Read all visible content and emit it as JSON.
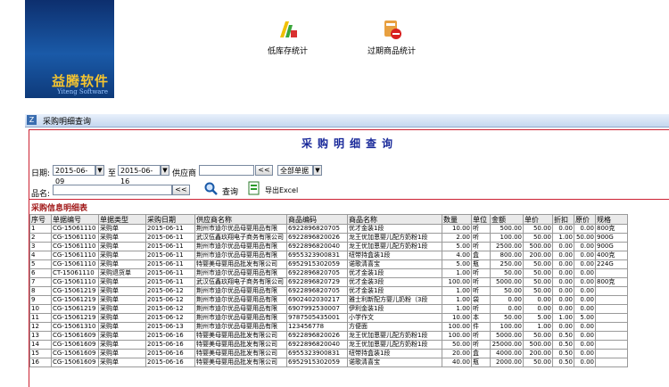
{
  "brand": {
    "logo": "益腾软件",
    "sub": "Yiteng Software"
  },
  "shortcuts": [
    {
      "label": "低库存统计",
      "icon": "low-stock-icon"
    },
    {
      "label": "过期商品统计",
      "icon": "expired-goods-icon"
    }
  ],
  "window": {
    "title": "采购明细查询",
    "heading": "采购明细查询"
  },
  "filters": {
    "date_label": "日期:",
    "date_from": "2015-06-09",
    "to_label": "至",
    "date_to": "2015-06-16",
    "supplier_label": "供应商",
    "supplier_value": "",
    "supplier_btn": "<<",
    "type_select": "全部单据",
    "product_label": "品名:",
    "product_value": "",
    "product_btn": "<<",
    "query_label": "查询",
    "export_label": "导出Excel"
  },
  "section_title": "采购信息明细表",
  "table": {
    "columns": [
      "序号",
      "单据编号",
      "单据类型",
      "采购日期",
      "供应商名称",
      "商品编码",
      "商品名称",
      "数量",
      "单位",
      "金额",
      "单价",
      "折扣",
      "原价",
      "规格"
    ],
    "rows": [
      [
        "1",
        "CG-15061110",
        "采购单",
        "2015-06-11",
        "荆州市迪尔优品母婴用品有限",
        "6922896820705",
        "优才金装1段",
        "10.00",
        "听",
        "500.00",
        "50.00",
        "0.00",
        "0.00",
        "800克"
      ],
      [
        "2",
        "CG-15061110",
        "采购单",
        "2015-06-11",
        "武汉伍鑫玖翔电子商务有限公司",
        "6922896820026",
        "龙王优加恩婴儿配方奶粉1段",
        "2.00",
        "听",
        "100.00",
        "50.00",
        "1.00",
        "50.00",
        "900G"
      ],
      [
        "3",
        "CG-15061110",
        "采购单",
        "2015-06-11",
        "荆州市迪尔优品母婴用品有限",
        "6922896820040",
        "龙王优加恩婴儿配方奶粉1段",
        "5.00",
        "听",
        "2500.00",
        "500.00",
        "0.00",
        "0.00",
        "900G"
      ],
      [
        "4",
        "CG-15061110",
        "采购单",
        "2015-06-11",
        "荆州市迪尔优品母婴用品有限",
        "6955323900831",
        "纽带持盒装1段",
        "4.00",
        "盒",
        "800.00",
        "200.00",
        "0.00",
        "0.00",
        "400克"
      ],
      [
        "5",
        "CG-15061110",
        "采购单",
        "2015-06-11",
        "特婴美母婴用品批发有限公司",
        "6952915302059",
        "诺歌清喜宝",
        "5.00",
        "瓶",
        "250.00",
        "50.00",
        "0.00",
        "0.00",
        "224G"
      ],
      [
        "6",
        "CT-15061110",
        "采购退货单",
        "2015-06-11",
        "荆州市迪尔优品母婴用品有限",
        "6922896820705",
        "优才金装1段",
        "1.00",
        "听",
        "50.00",
        "50.00",
        "0.00",
        "0.00",
        ""
      ],
      [
        "7",
        "CG-15061110",
        "采购单",
        "2015-06-11",
        "武汉伍鑫玖翔电子商务有限公司",
        "6922896820729",
        "优才金装3段",
        "100.00",
        "听",
        "5000.00",
        "50.00",
        "0.00",
        "0.00",
        "800克"
      ],
      [
        "8",
        "CG-15061219",
        "采购单",
        "2015-06-12",
        "荆州市迪尔优品母婴用品有限",
        "6922896820705",
        "优才金装1段",
        "1.00",
        "听",
        "50.00",
        "50.00",
        "0.00",
        "0.00",
        ""
      ],
      [
        "9",
        "CG-15061219",
        "采购单",
        "2015-06-12",
        "荆州市迪尔优品母婴用品有限",
        "6902402030217",
        "雅士利新配方婴儿奶粉（3段",
        "1.00",
        "袋",
        "0.00",
        "0.00",
        "0.00",
        "0.00",
        ""
      ],
      [
        "10",
        "CG-15061219",
        "采购单",
        "2015-06-12",
        "荆州市迪尔优品母婴用品有限",
        "6907992530007",
        "伊利金装1段",
        "1.00",
        "听",
        "0.00",
        "0.00",
        "0.00",
        "0.00",
        ""
      ],
      [
        "11",
        "CG-15061219",
        "采购单",
        "2015-06-12",
        "荆州市迪尔优品母婴用品有限",
        "9787505435001",
        "小学作文",
        "10.00",
        "本",
        "50.00",
        "5.00",
        "1.00",
        "5.00",
        ""
      ],
      [
        "12",
        "CG-15061310",
        "采购单",
        "2015-06-13",
        "荆州市迪尔优品母婴用品有限",
        "123456778",
        "方便面",
        "100.00",
        "件",
        "100.00",
        "1.00",
        "0.00",
        "0.00",
        ""
      ],
      [
        "13",
        "CG-15061609",
        "采购单",
        "2015-06-16",
        "特婴美母婴用品批发有限公司",
        "6922896820026",
        "龙王优加恩婴儿配方奶粉1段",
        "100.00",
        "听",
        "5000.00",
        "50.00",
        "0.50",
        "0.00",
        ""
      ],
      [
        "14",
        "CG-15061609",
        "采购单",
        "2015-06-16",
        "特婴美母婴用品批发有限公司",
        "6922896820040",
        "龙王优加恩婴儿配方奶粉1段",
        "50.00",
        "听",
        "25000.00",
        "500.00",
        "0.50",
        "0.00",
        ""
      ],
      [
        "15",
        "CG-15061609",
        "采购单",
        "2015-06-16",
        "特婴美母婴用品批发有限公司",
        "6955323900831",
        "纽带持盒装1段",
        "20.00",
        "盒",
        "4000.00",
        "200.00",
        "0.50",
        "0.00",
        ""
      ],
      [
        "16",
        "CG-15061609",
        "采购单",
        "2015-06-16",
        "特婴美母婴用品批发有限公司",
        "6952915302059",
        "诺歌清喜宝",
        "40.00",
        "瓶",
        "2000.00",
        "50.00",
        "0.50",
        "0.00",
        ""
      ]
    ]
  }
}
